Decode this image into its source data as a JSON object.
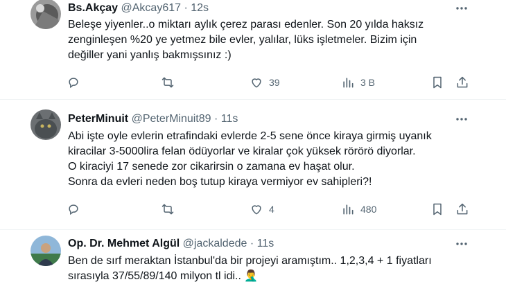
{
  "tweets": [
    {
      "name": "Bs.Akçay",
      "handle": "@Akcay617",
      "separator": "·",
      "time": "12s",
      "lines": [
        "Beleşe yiyenler..o miktarı aylık çerez parası edenler. Son 20 yılda haksız",
        "zenginleşen %20 ye yetmez bile evler, yalılar, lüks işletmeler. Bizim için",
        "değiller yani yanlış bakmışsınız :)"
      ],
      "likes": "39",
      "views": "3 B"
    },
    {
      "name": "PeterMinuit",
      "handle": "@PeterMinuit89",
      "separator": "·",
      "time": "11s",
      "lines": [
        "Abi işte oyle evlerin etrafindaki evlerde 2-5  sene önce kiraya girmiş uyanık",
        "kiracilar 3-5000lira felan ödüyorlar ve kiralar çok yüksek rörörö diyorlar.",
        "O kiraciyi 17 senede zor cikarirsin o zamana ev haşat olur.",
        "Sonra da evleri neden boş tutup kiraya vermiyor ev sahipleri?!"
      ],
      "likes": "4",
      "views": "480"
    },
    {
      "name": "Op. Dr. Mehmet Algül",
      "handle": "@jackaldede",
      "separator": "·",
      "time": "11s",
      "lines": [
        "Ben de sırf meraktan İstanbul'da bir projeyi aramıştım.. 1,2,3,4 + 1 fiyatları",
        "sırasıyla 37/55/89/140 milyon tl idi.. 🤦‍♂️"
      ]
    }
  ],
  "icons": {
    "more": "more-horizontal-icon",
    "reply": "reply-icon",
    "retweet": "retweet-icon",
    "like": "heart-icon",
    "views": "views-icon",
    "bookmark": "bookmark-icon",
    "share": "share-icon"
  },
  "colors": {
    "text": "#0f1419",
    "secondary": "#536471",
    "divider": "#eff3f4"
  }
}
